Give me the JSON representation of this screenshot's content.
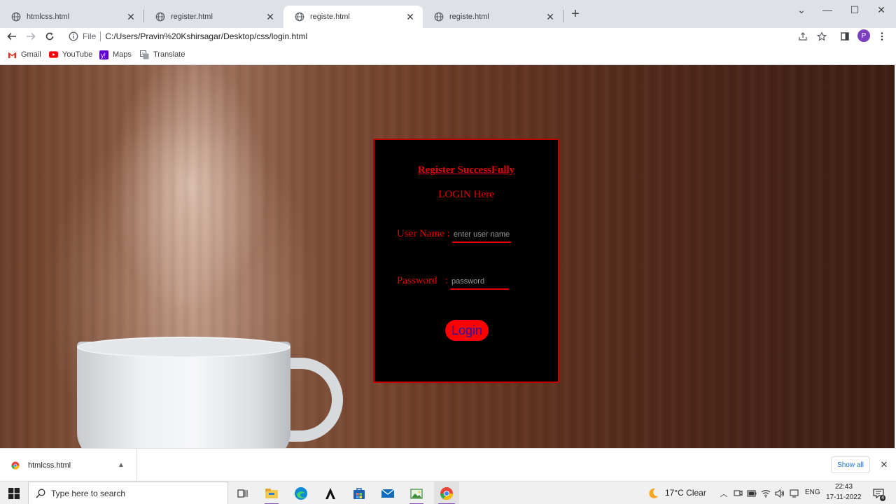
{
  "browser": {
    "tabs": [
      {
        "title": "htmlcss.html",
        "active": false
      },
      {
        "title": "register.html",
        "active": false
      },
      {
        "title": "registe.html",
        "active": true
      },
      {
        "title": "registe.html",
        "active": false
      }
    ],
    "new_tab_label": "+",
    "address": {
      "scheme_label": "File",
      "url": "C:/Users/Pravin%20Kshirsagar/Desktop/css/login.html"
    },
    "profile_initial": "P",
    "bookmarks": [
      {
        "label": "Gmail",
        "icon": "gmail-icon"
      },
      {
        "label": "YouTube",
        "icon": "youtube-icon"
      },
      {
        "label": "Maps",
        "icon": "maps-icon"
      },
      {
        "label": "Translate",
        "icon": "translate-icon"
      }
    ]
  },
  "page": {
    "register_message": "Register SuccessFully",
    "login_heading": "LOGIN Here",
    "username": {
      "label": "User Name :",
      "placeholder": "enter user name",
      "value": ""
    },
    "password": {
      "label": "Password   :",
      "placeholder": "password",
      "value": ""
    },
    "login_button": "Login",
    "colors": {
      "accent": "#e00000",
      "panel_bg": "#000000",
      "button_text": "#1a1aa8"
    }
  },
  "downloads": {
    "file_name": "htmlcss.html",
    "show_all_label": "Show all"
  },
  "taskbar": {
    "search_placeholder": "Type here to search",
    "weather": "17°C  Clear",
    "language": "ENG",
    "time": "22:43",
    "date": "17-11-2022",
    "notification_count": "4"
  }
}
